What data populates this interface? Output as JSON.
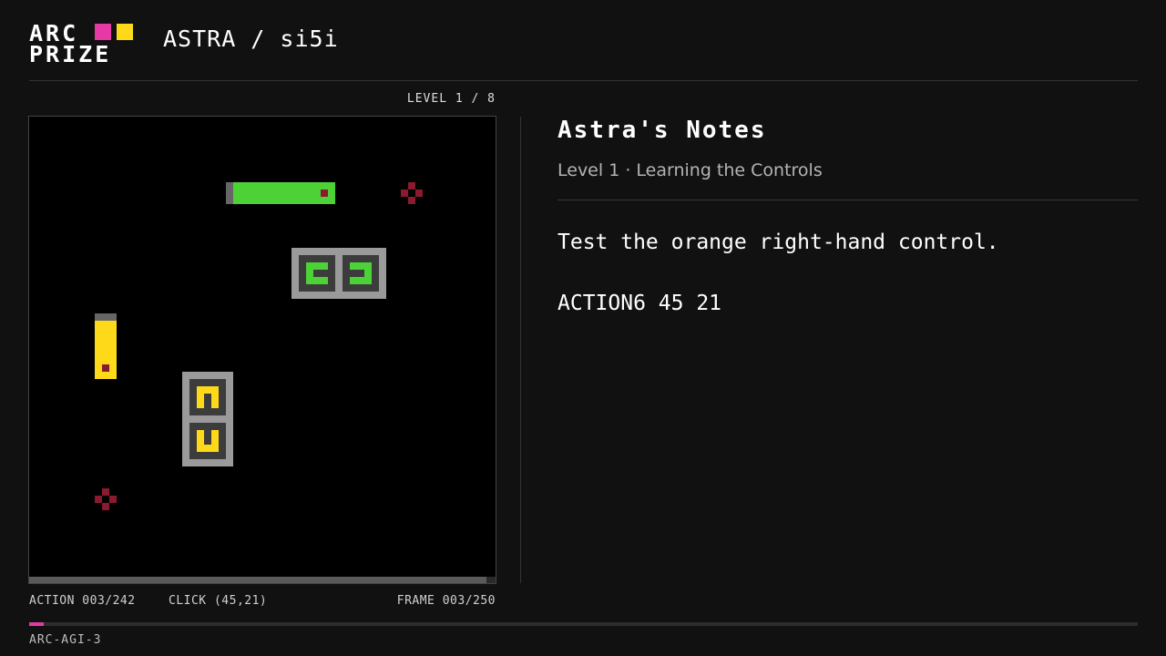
{
  "header": {
    "logo_line1": "ARC",
    "logo_line2": "PRIZE",
    "title": "ASTRA / si5i"
  },
  "colors": {
    "pink": "#e53aa6",
    "yellow": "#fdd919",
    "green": "#4cd137",
    "dark_red": "#8b1a2f",
    "gray": "#9a9a9a",
    "dark_gray": "#3c3c3c"
  },
  "level": {
    "label": "LEVEL 1 / 8"
  },
  "game": {
    "frame_progress": 0.98
  },
  "stats": {
    "action": "ACTION 003/242",
    "click": "CLICK (45,21)",
    "frame": "FRAME 003/250"
  },
  "notes": {
    "title": "Astra's Notes",
    "subtitle": "Level 1 · Learning the Controls",
    "text": "Test the orange right-hand control.",
    "action": "ACTION6 45 21"
  },
  "progress": {
    "fraction": 0.0131
  },
  "footer": {
    "label": "ARC-AGI-3"
  }
}
